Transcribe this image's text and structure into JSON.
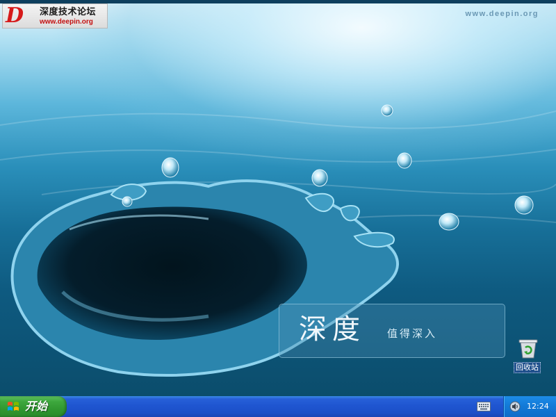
{
  "desktop": {
    "logo": {
      "mark": "D",
      "title": "深度技术论坛",
      "url": "www.deepin.org"
    },
    "site_url": "www.deepin.org",
    "banner": {
      "title": "深度",
      "subtitle": "值得深入"
    },
    "icons": [
      {
        "name": "recycle-bin",
        "label": "回收站",
        "icon": "recycle-bin-icon"
      }
    ]
  },
  "taskbar": {
    "start_label": "开始",
    "tray_icons": [
      "keyboard-icon",
      "volume-icon"
    ],
    "clock": "12:24"
  },
  "colors": {
    "taskbar": "#2255d0",
    "start_button": "#3a9d3a",
    "tray": "#1279d6",
    "water": "#176f98"
  }
}
